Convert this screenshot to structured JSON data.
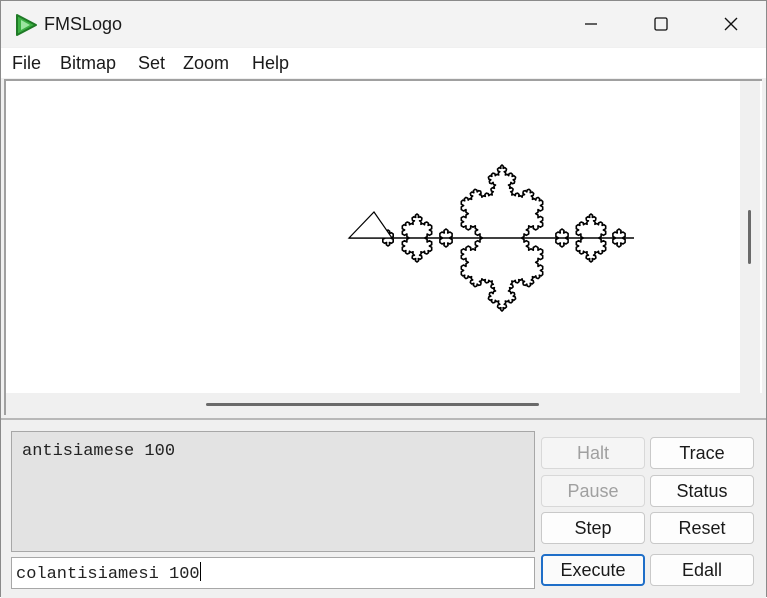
{
  "window": {
    "title": "FMSLogo"
  },
  "menu": [
    {
      "label": "File"
    },
    {
      "label": "Bitmap"
    },
    {
      "label": "Set"
    },
    {
      "label": "Zoom"
    },
    {
      "label": "Help"
    }
  ],
  "commander": {
    "history": [
      "antisiamese 100"
    ],
    "input_value": "colantisiamesi 100",
    "buttons": {
      "halt": "Halt",
      "trace": "Trace",
      "pause": "Pause",
      "status": "Status",
      "step": "Step",
      "reset": "Reset",
      "execute": "Execute",
      "edall": "Edall"
    }
  },
  "colors": {
    "accent": "#1e6ec8",
    "app_icon": "#3cb043"
  }
}
